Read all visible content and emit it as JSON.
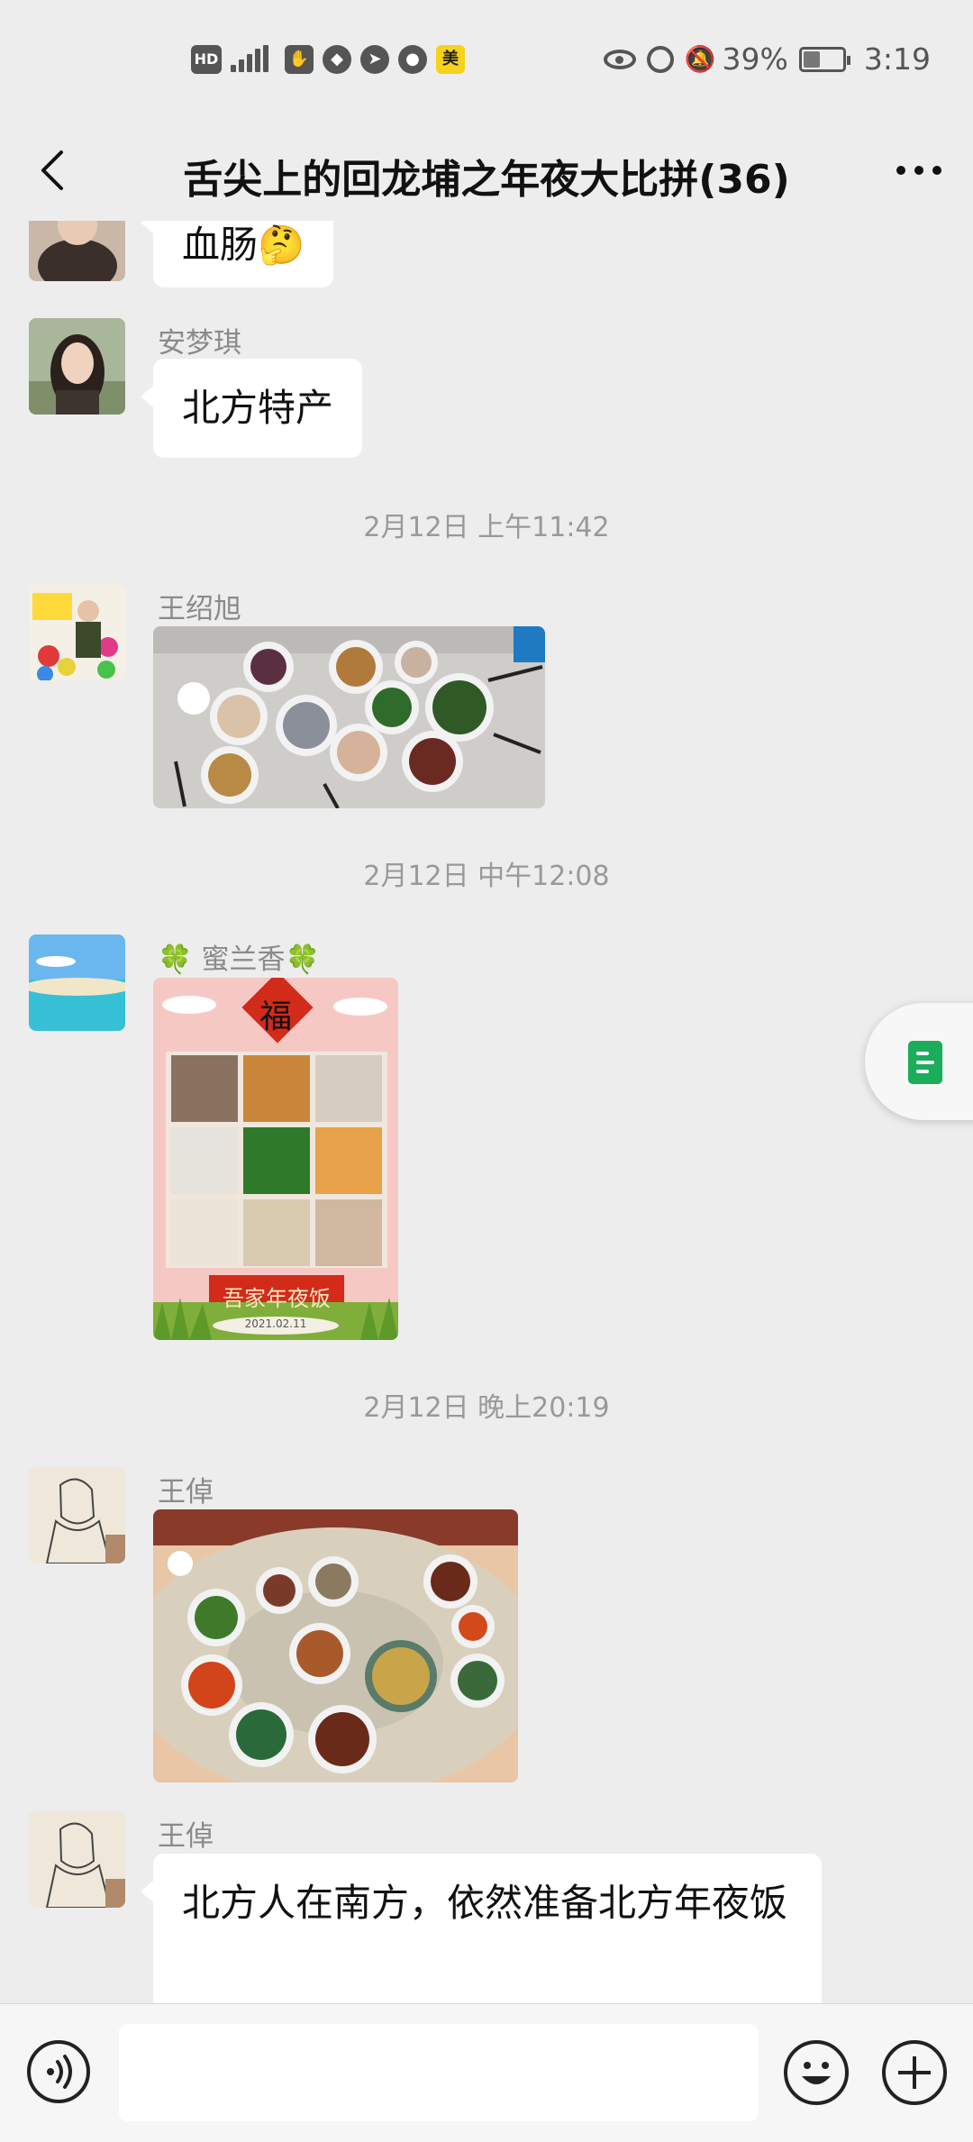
{
  "status_bar": {
    "left_icons": [
      "hd-icon",
      "5g-signal-icon",
      "hand-icon",
      "app-icon",
      "send-icon",
      "chat-icon",
      "meituan-icon"
    ],
    "hd_label": "HD",
    "mei_label": "美",
    "battery_percent": "39%",
    "time": "3:19"
  },
  "title_bar": {
    "title": "舌尖上的回龙埔之年夜大比拼(36)"
  },
  "messages": [
    {
      "type": "text",
      "sender": "",
      "text": "血肠🤔"
    },
    {
      "type": "text",
      "sender": "安梦琪",
      "text": "北方特产"
    },
    {
      "type": "timestamp",
      "text": "2月12日 上午11:42"
    },
    {
      "type": "image",
      "sender": "王绍旭",
      "alt": "年夜饭菜品照片"
    },
    {
      "type": "timestamp",
      "text": "2月12日 中午12:08"
    },
    {
      "type": "image",
      "sender": "🍀 蜜兰香🍀",
      "poster": {
        "fu": "福",
        "caption": "吾家年夜饭",
        "date": "2021.02.11"
      }
    },
    {
      "type": "timestamp",
      "text": "2月12日 晚上20:19"
    },
    {
      "type": "image",
      "sender": "王倬",
      "alt": "圆桌年夜饭照片"
    },
    {
      "type": "text",
      "sender": "王倬",
      "text": "北方人在南方，依然准备北方年夜饭"
    }
  ],
  "input_bar": {
    "placeholder": ""
  },
  "colors": {
    "background": "#ededed",
    "bubble": "#ffffff",
    "accent_green": "#1aad5a",
    "timestamp_text": "#999999",
    "sender_text": "#8a8a8a"
  }
}
